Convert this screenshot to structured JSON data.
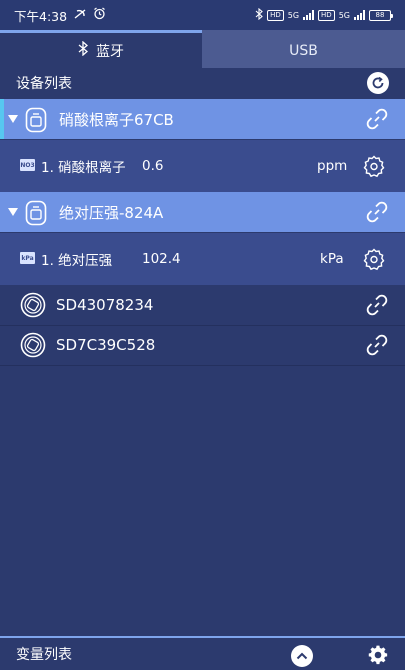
{
  "status": {
    "time": "下午4:38",
    "net1": "5G",
    "net2": "5G",
    "battery": "88"
  },
  "tabs": [
    {
      "label": "蓝牙"
    },
    {
      "label": "USB"
    }
  ],
  "device_list": {
    "title": "设备列表"
  },
  "devices": [
    {
      "name": "硝酸根离子67CB",
      "expanded": true,
      "variable": {
        "label": "1. 硝酸根离子",
        "value": "0.6",
        "unit": "ppm",
        "badge": "NO3"
      }
    },
    {
      "name": "绝对压强-824A",
      "expanded": true,
      "variable": {
        "label": "1. 绝对压强",
        "value": "102.4",
        "unit": "kPa",
        "badge": "kPa"
      }
    },
    {
      "name": "SD43078234",
      "expanded": false
    },
    {
      "name": "SD7C39C528",
      "expanded": false
    }
  ],
  "bottom": {
    "title": "变量列表"
  },
  "colors": {
    "background": "#2c3a6e",
    "expanded_row": "#6f93e4",
    "variable_row": "#3a4c8e",
    "accent": "#57c7f0",
    "tab_inactive": "#4c5b91"
  }
}
